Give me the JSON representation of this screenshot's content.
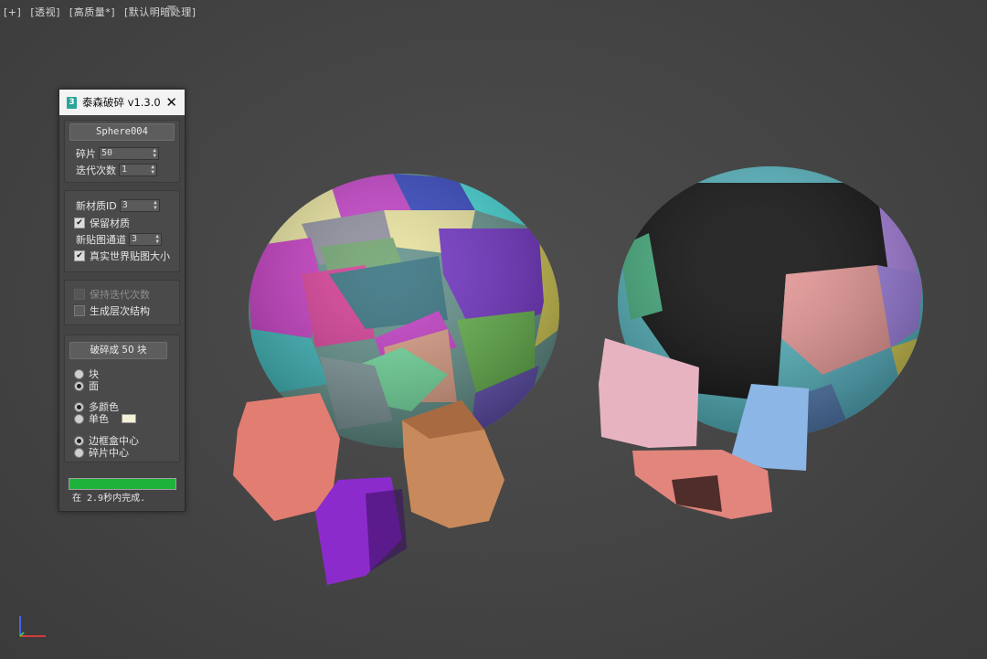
{
  "viewport": {
    "labels": [
      "[+]",
      "[透视]",
      "[高质量*]",
      "[默认明暗处理]"
    ],
    "filter_icon": "funnel-icon"
  },
  "panel": {
    "title": "泰森破碎 v1.3.0",
    "app_icon": "3",
    "close": "✕",
    "object_button": "Sphere004",
    "fragments_label": "碎片",
    "fragments_value": "50",
    "iterations_label": "迭代次数",
    "iterations_value": "1",
    "new_material_id_label": "新材质ID",
    "new_material_id_value": "3",
    "keep_material_label": "保留材质",
    "keep_material_checked": true,
    "new_map_channel_label": "新贴图通道",
    "new_map_channel_value": "3",
    "real_world_map_label": "真实世界贴图大小",
    "real_world_map_checked": true,
    "keep_iterations_label": "保持迭代次数",
    "keep_iterations_checked": false,
    "generate_hierarchy_label": "生成层次结构",
    "generate_hierarchy_checked": false,
    "fracture_button": "破碎成 50 块",
    "radio_block": "块",
    "radio_face": "面",
    "radio_multicolor": "多颜色",
    "radio_single_color": "单色",
    "single_color_swatch": "#f4f2d6",
    "radio_bbox_center": "边框盒中心",
    "radio_fragment_center": "碎片中心",
    "progress": 1.0,
    "status_text": "在 2.9秒内完成.",
    "progress_color": "#1fb23b"
  }
}
